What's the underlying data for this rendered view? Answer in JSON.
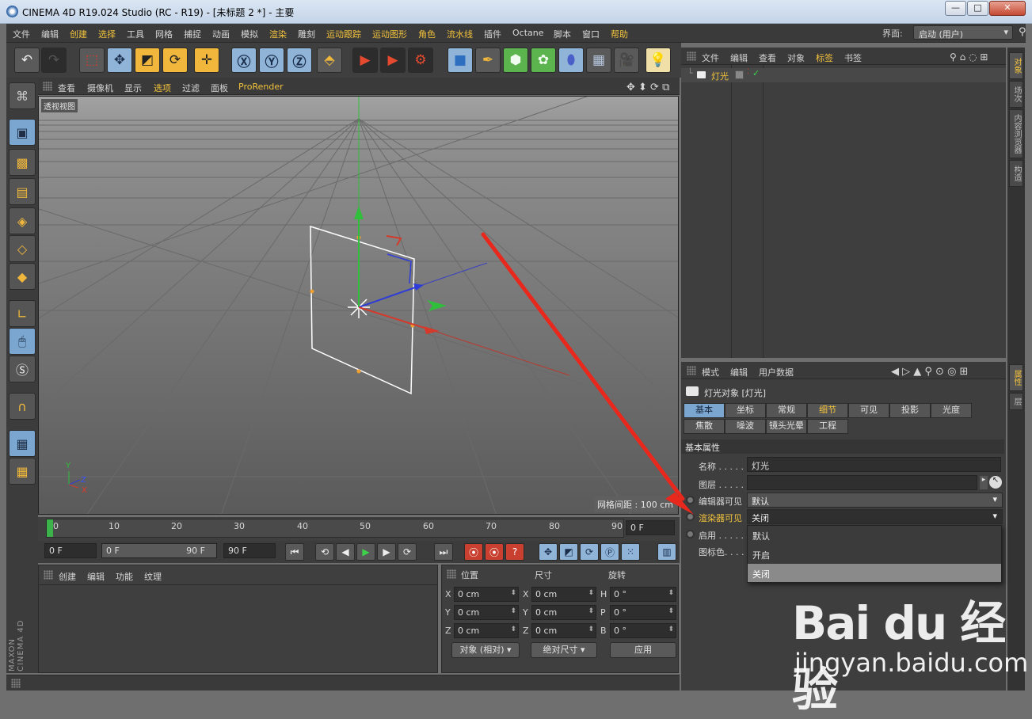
{
  "window": {
    "title": "CINEMA 4D R19.024 Studio (RC - R19) - [未标题 2 *] - 主要",
    "minimize": "—",
    "maximize": "□",
    "close": "✕"
  },
  "menubar": {
    "items": [
      "文件",
      "编辑",
      "创建",
      "选择",
      "工具",
      "网格",
      "捕捉",
      "动画",
      "模拟",
      "渲染",
      "雕刻",
      "运动跟踪",
      "运动图形",
      "角色",
      "流水线",
      "插件",
      "Octane",
      "脚本",
      "窗口",
      "帮助"
    ],
    "layout_label": "界面:",
    "layout_value": "启动 (用户)"
  },
  "viewport": {
    "menu": [
      "查看",
      "摄像机",
      "显示",
      "选项",
      "过滤",
      "面板",
      "ProRender"
    ],
    "label": "透视视图",
    "grid_spacing": "网格间距 : 100 cm",
    "axis": {
      "x": "X",
      "y": "Y",
      "z": "Z"
    }
  },
  "timeline": {
    "ticks": [
      "0",
      "10",
      "20",
      "30",
      "40",
      "50",
      "60",
      "70",
      "80",
      "90"
    ],
    "current_frame": "0 F",
    "start": "0 F",
    "range_start": "0 F",
    "range_end": "90 F",
    "end": "90 F"
  },
  "material_panel": {
    "menu": [
      "创建",
      "编辑",
      "功能",
      "纹理"
    ]
  },
  "coord_panel": {
    "headers": [
      "位置",
      "尺寸",
      "旋转"
    ],
    "rows": [
      {
        "a": "X",
        "pos": "0 cm",
        "b": "X",
        "size": "0 cm",
        "c": "H",
        "rot": "0 °"
      },
      {
        "a": "Y",
        "pos": "0 cm",
        "b": "Y",
        "size": "0 cm",
        "c": "P",
        "rot": "0 °"
      },
      {
        "a": "Z",
        "pos": "0 cm",
        "b": "Z",
        "size": "0 cm",
        "c": "B",
        "rot": "0 °"
      }
    ],
    "mode": "对象 (相对)",
    "size_mode": "绝对尺寸",
    "apply": "应用"
  },
  "object_manager": {
    "menu": [
      "文件",
      "编辑",
      "查看",
      "对象",
      "标签",
      "书签"
    ],
    "objects": [
      {
        "name": "灯光"
      }
    ]
  },
  "right_tabs": [
    "对象",
    "场次",
    "内容浏览器",
    "构造",
    "属性",
    "层"
  ],
  "attribute_manager": {
    "menu": [
      "模式",
      "编辑",
      "用户数据"
    ],
    "title": "灯光对象 [灯光]",
    "tabs_row1": [
      "基本",
      "坐标",
      "常规",
      "细节",
      "可见",
      "投影",
      "光度"
    ],
    "tabs_row2": [
      "焦散",
      "噪波",
      "镜头光晕",
      "工程"
    ],
    "section": "基本属性",
    "fields": {
      "name_label": "名称 . . . . .",
      "name_value": "灯光",
      "layer_label": "图层 . . . . .",
      "layer_value": "",
      "editor_vis_label": "编辑器可见",
      "editor_vis_value": "默认",
      "render_vis_label": "渲染器可见",
      "render_vis_value": "关闭",
      "enable_label": "启用 . . . . .",
      "icon_color_label": "图标色. . . ."
    },
    "dropdown_options": [
      "默认",
      "开启",
      "关闭"
    ],
    "dropdown_selected": "关闭"
  },
  "watermark": {
    "logo": "Bai du 经验",
    "url": "jingyan.baidu.com"
  },
  "colors": {
    "accent": "#f2c23c",
    "selection": "#7aa6d0",
    "annotation_arrow": "#e8281c",
    "light_x_axis": "#d43a2c",
    "light_y_axis": "#2fbf3a",
    "light_z_axis": "#2e3cd8"
  }
}
